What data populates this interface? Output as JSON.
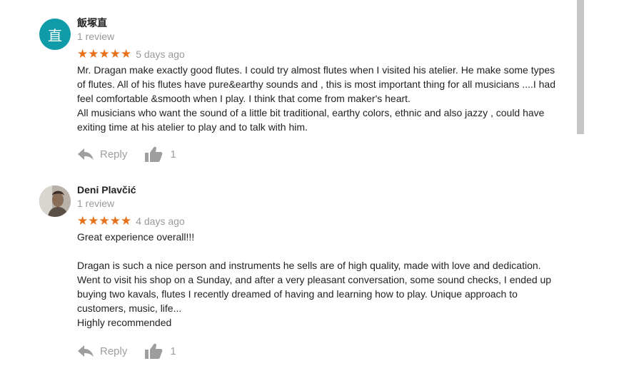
{
  "colors": {
    "star": "#e7711b",
    "avatar_bg": "#0f9ba8",
    "muted_text": "#999999"
  },
  "reviews": [
    {
      "avatar_letter": "直",
      "author": "飯塚直",
      "review_count": "1 review",
      "rating": 5,
      "stars": "★★★★★",
      "date": "5 days ago",
      "text": "Mr. Dragan make exactly good flutes. I could try almost flutes when I visited his atelier.  He make some types of flutes.  All of his flutes have pure&earthy  sounds and , this is most important thing for all musicians ....I had feel comfortable &smooth when I play.  I think that come from maker's heart.\nAll musicians who want the sound of a little bit traditional, earthy colors, ethnic and also jazzy , could have exiting time at his atelier to play and to talk with him.",
      "reply_label": "Reply",
      "likes": "1"
    },
    {
      "author": "Deni Plavčić",
      "review_count": "1 review",
      "rating": 5,
      "stars": "★★★★★",
      "date": "4 days ago",
      "text": "Great experience overall!!!\n\nDragan is such a nice person and instruments he sells are of high quality, made with love and dedication. Went to visit his shop on a Sunday, and after a very pleasant conversation, some sound checks, I ended up buying two kavals, flutes I recently dreamed of having and learning how to play. Unique approach to customers, music, life...\nHighly recommended",
      "reply_label": "Reply",
      "likes": "1"
    }
  ]
}
